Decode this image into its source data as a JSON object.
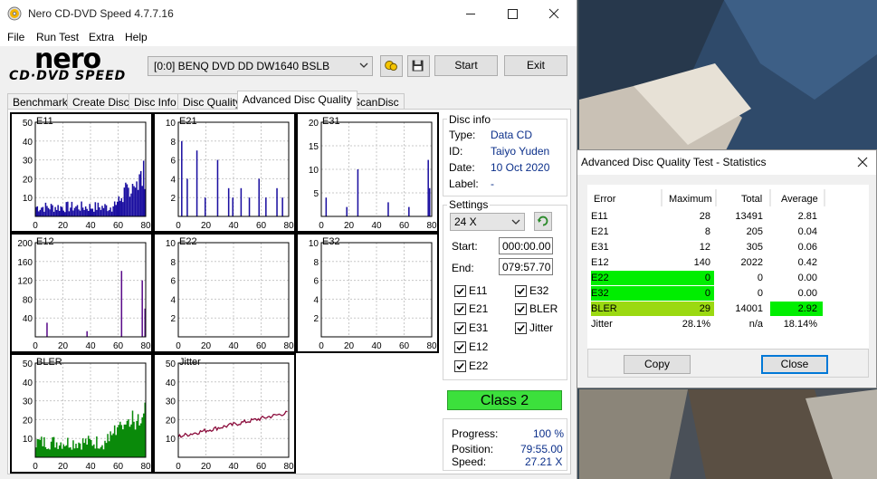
{
  "window": {
    "title": "Nero CD-DVD Speed 4.7.7.16"
  },
  "menu": [
    "File",
    "Run Test",
    "Extra",
    "Help"
  ],
  "logo": {
    "line1": "nero",
    "line2": "CD·DVD SPEED"
  },
  "toolbar": {
    "drive": "[0:0]  BENQ DVD DD DW1640 BSLB",
    "start_label": "Start",
    "exit_label": "Exit"
  },
  "tabs": [
    "Benchmark",
    "Create Disc",
    "Disc Info",
    "Disc Quality",
    "Advanced Disc Quality",
    "ScanDisc"
  ],
  "active_tab": "Advanced Disc Quality",
  "disc_info": {
    "title": "Disc info",
    "type_label": "Type:",
    "type_value": "Data CD",
    "id_label": "ID:",
    "id_value": "Taiyo Yuden",
    "date_label": "Date:",
    "date_value": "10 Oct 2020",
    "label_label": "Label:",
    "label_value": "-"
  },
  "settings": {
    "title": "Settings",
    "speed": "24 X",
    "start_label": "Start:",
    "start_value": "000:00.00",
    "end_label": "End:",
    "end_value": "079:57.70",
    "checks": [
      {
        "label": "E11",
        "checked": true
      },
      {
        "label": "E32",
        "checked": true
      },
      {
        "label": "E21",
        "checked": true
      },
      {
        "label": "BLER",
        "checked": true
      },
      {
        "label": "E31",
        "checked": true
      },
      {
        "label": "Jitter",
        "checked": true
      },
      {
        "label": "E12",
        "checked": true
      },
      {
        "label": "E22",
        "checked": true
      }
    ]
  },
  "class_label": "Class 2",
  "progress": {
    "progress_label": "Progress:",
    "progress_value": "100 %",
    "position_label": "Position:",
    "position_value": "79:55.00",
    "speed_label": "Speed:",
    "speed_value": "27.21 X"
  },
  "chart_data": [
    {
      "name": "E11",
      "type": "bar",
      "ylim": [
        0,
        50
      ],
      "yticks": [
        10,
        20,
        30,
        40,
        50
      ],
      "xticks": [
        0,
        20,
        40,
        60,
        80
      ],
      "color": "#1a0ea0"
    },
    {
      "name": "E21",
      "type": "bar",
      "ylim": [
        0,
        10
      ],
      "yticks": [
        2,
        4,
        6,
        8,
        10
      ],
      "xticks": [
        0,
        20,
        40,
        60,
        80
      ],
      "color": "#1a0ea0"
    },
    {
      "name": "E31",
      "type": "bar",
      "ylim": [
        0,
        20
      ],
      "yticks": [
        5,
        10,
        15,
        20
      ],
      "xticks": [
        0,
        20,
        40,
        60,
        80
      ],
      "color": "#1a0ea0"
    },
    {
      "name": "E12",
      "type": "bar",
      "ylim": [
        0,
        200
      ],
      "yticks": [
        40,
        80,
        120,
        160,
        200
      ],
      "xticks": [
        0,
        20,
        40,
        60,
        80
      ],
      "color": "#5a0c8a"
    },
    {
      "name": "E22",
      "type": "bar",
      "ylim": [
        0,
        10
      ],
      "yticks": [
        2,
        4,
        6,
        8,
        10
      ],
      "xticks": [
        0,
        20,
        40,
        60,
        80
      ],
      "color": "#1a0ea0"
    },
    {
      "name": "E32",
      "type": "bar",
      "ylim": [
        0,
        10
      ],
      "yticks": [
        2,
        4,
        6,
        8,
        10
      ],
      "xticks": [
        0,
        20,
        40,
        60,
        80
      ],
      "color": "#1a0ea0"
    },
    {
      "name": "BLER",
      "type": "area",
      "ylim": [
        0,
        50
      ],
      "yticks": [
        10,
        20,
        30,
        40,
        50
      ],
      "xticks": [
        0,
        20,
        40,
        60,
        80
      ],
      "color": "#0a8a0a"
    },
    {
      "name": "Jitter",
      "type": "line",
      "ylim": [
        0,
        50
      ],
      "yticks": [
        10,
        20,
        30,
        40,
        50
      ],
      "xticks": [
        0,
        20,
        40,
        60,
        80
      ],
      "color": "#8a0a3a"
    }
  ],
  "stats": {
    "title": "Advanced Disc Quality Test - Statistics",
    "headers": [
      "Error",
      "Maximum",
      "Total",
      "Average"
    ],
    "rows": [
      {
        "error": "E11",
        "max": "28",
        "total": "13491",
        "avg": "2.81"
      },
      {
        "error": "E21",
        "max": "8",
        "total": "205",
        "avg": "0.04"
      },
      {
        "error": "E31",
        "max": "12",
        "total": "305",
        "avg": "0.06"
      },
      {
        "error": "E12",
        "max": "140",
        "total": "2022",
        "avg": "0.42"
      },
      {
        "error": "E22",
        "max": "0",
        "total": "0",
        "avg": "0.00"
      },
      {
        "error": "E32",
        "max": "0",
        "total": "0",
        "avg": "0.00"
      },
      {
        "error": "BLER",
        "max": "29",
        "total": "14001",
        "avg": "2.92"
      },
      {
        "error": "Jitter",
        "max": "28.1%",
        "total": "n/a",
        "avg": "18.14%"
      }
    ],
    "copy_label": "Copy",
    "close_label": "Close"
  },
  "colors": {
    "class_badge": "#3ce03c",
    "highlight_green": "#00ee00",
    "highlight_lime": "#9bd911"
  }
}
